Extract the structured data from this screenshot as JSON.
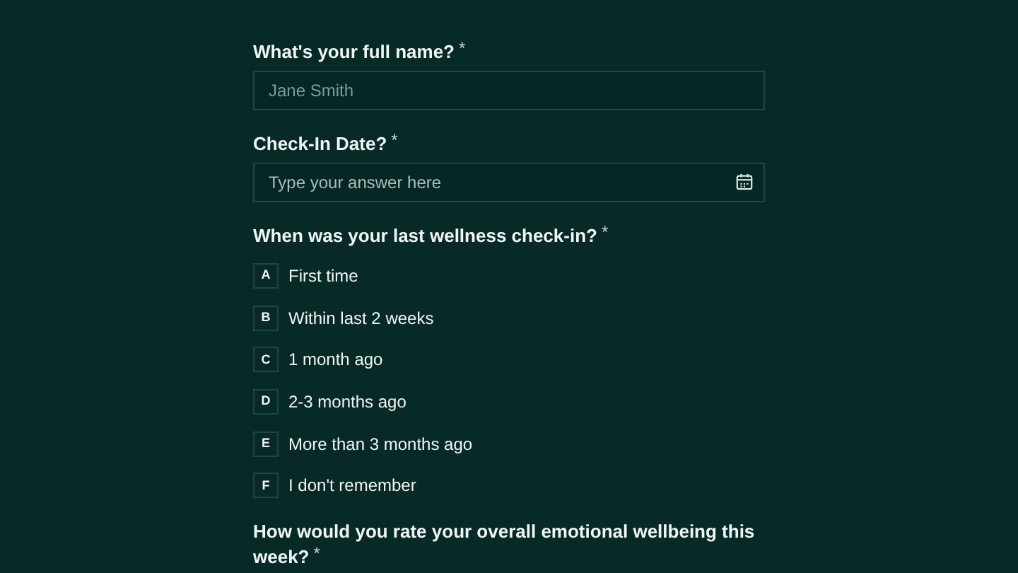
{
  "questions": [
    {
      "kind": "text",
      "label": "What's your full name?",
      "required_mark": "*",
      "placeholder": "Jane Smith"
    },
    {
      "kind": "date",
      "label": "Check-In Date?",
      "required_mark": "*",
      "placeholder": "Type your answer here"
    },
    {
      "kind": "choice",
      "label": "When was your last wellness check-in?",
      "required_mark": "*",
      "options": [
        {
          "key": "A",
          "label": "First time",
          "selected": false
        },
        {
          "key": "B",
          "label": "Within last 2 weeks",
          "selected": false
        },
        {
          "key": "C",
          "label": "1 month ago",
          "selected": false
        },
        {
          "key": "D",
          "label": "2-3 months ago",
          "selected": false
        },
        {
          "key": "E",
          "label": "More than 3 months ago",
          "selected": false
        },
        {
          "key": "F",
          "label": "I don't remember",
          "selected": false
        }
      ]
    },
    {
      "kind": "heading",
      "label": "How would you rate your overall emotional wellbeing this week?",
      "required_mark": "*"
    }
  ]
}
